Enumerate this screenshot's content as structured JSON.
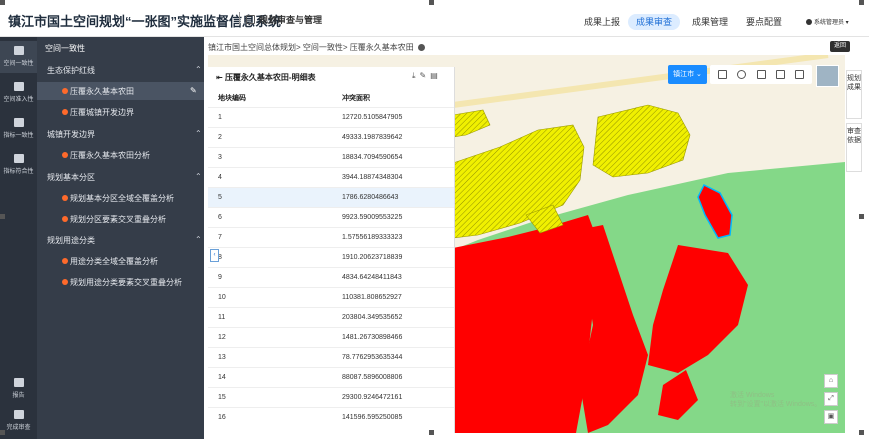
{
  "header": {
    "app_title": "镇江市国土空间规划“一张图”实施监督信息系统",
    "module_label": "规划审查与管理",
    "nav": [
      "成果上报",
      "成果审查",
      "成果管理",
      "要点配置"
    ],
    "active_nav": "成果审查",
    "user_label": "系统管理员"
  },
  "iconbar": {
    "items": [
      "空间一致性",
      "空间准入性",
      "指标一致性",
      "指标符合性"
    ],
    "bottom": [
      "报告",
      "完成审查"
    ]
  },
  "tree": {
    "title": "空间一致性",
    "groups": [
      {
        "label": "生态保护红线",
        "items": [
          "压覆永久基本农田",
          "压覆城镇开发边界"
        ]
      },
      {
        "label": "城镇开发边界",
        "items": [
          "压覆永久基本农田分析"
        ]
      },
      {
        "label": "规划基本分区",
        "items": [
          "规划基本分区全域全覆盖分析",
          "规划分区要素交叉重叠分析"
        ]
      },
      {
        "label": "规划用途分类",
        "items": [
          "用途分类全域全覆盖分析",
          "规划用途分类要素交叉重叠分析"
        ]
      }
    ],
    "active_item": "压覆永久基本农田"
  },
  "breadcrumb": "镇江市国土空间总体规划> 空间一致性> 压覆永久基本农田",
  "back_label": "返回",
  "table": {
    "title": "压覆永久基本农田-明细表",
    "columns": [
      "地块编码",
      "冲突面积"
    ],
    "rows": [
      [
        "1",
        "12720.5105847905"
      ],
      [
        "2",
        "49333.1987839642"
      ],
      [
        "3",
        "18834.7094590654"
      ],
      [
        "4",
        "3944.18874348304"
      ],
      [
        "5",
        "1786.6280486643"
      ],
      [
        "6",
        "9923.59009553225"
      ],
      [
        "7",
        "1.57556189333323"
      ],
      [
        "8",
        "1910.20623718839"
      ],
      [
        "9",
        "4834.64248411843"
      ],
      [
        "10",
        "110381.808652927"
      ],
      [
        "11",
        "203804.349535652"
      ],
      [
        "12",
        "1481.26730898466"
      ],
      [
        "13",
        "78.7762953635344"
      ],
      [
        "14",
        "88087.5896008806"
      ],
      [
        "15",
        "29300.9246472161"
      ],
      [
        "16",
        "141596.595250085"
      ]
    ],
    "selected_row": "5"
  },
  "map": {
    "city_selector": "镇江市",
    "side_tabs": [
      "规划成果",
      "审查依据"
    ],
    "watermark": [
      "激活 Windows",
      "转到\"设置\"以激活 Windows。"
    ],
    "colors": {
      "farmland": "#84d888",
      "conflict": "#ff0000",
      "redline_hatch": "#f0f000",
      "selected_outline": "#00b7ff",
      "background": "#f6f1e3"
    }
  }
}
